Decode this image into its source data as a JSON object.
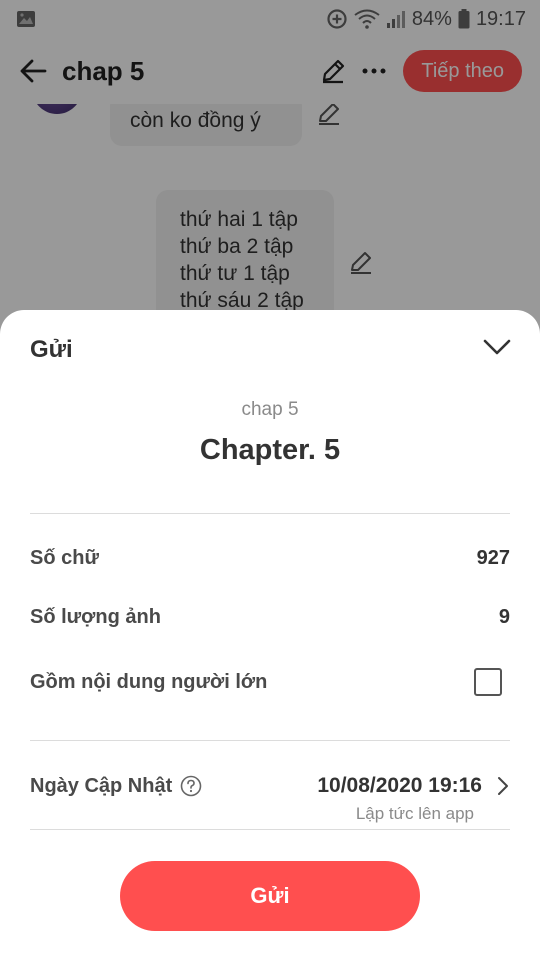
{
  "status_bar": {
    "battery": "84%",
    "time": "19:17"
  },
  "app_bar": {
    "title": "chap 5",
    "next_label": "Tiếp theo"
  },
  "chat": {
    "message_1": "còn ko đồng ý",
    "message_2_lines": [
      "thứ hai 1 tập",
      "thứ ba 2 tập",
      "thứ tư 1 tập",
      "thứ sáu 2 tập"
    ]
  },
  "sheet": {
    "title": "Gửi",
    "chapter_sub": "chap 5",
    "chapter_name": "Chapter. 5",
    "word_count_label": "Số chữ",
    "word_count_value": "927",
    "image_count_label": "Số lượng ảnh",
    "image_count_value": "9",
    "adult_label": "Gồm nội dung người lớn",
    "adult_checked": false,
    "date_label": "Ngày Cập Nhật",
    "date_value": "10/08/2020 19:16",
    "date_sub": "Lập tức lên app",
    "send_label": "Gửi"
  },
  "colors": {
    "accent": "#ff4f4f",
    "overlay": "rgba(0,0,0,0.40)",
    "text_dark": "#333333",
    "text_muted": "#8a8a8a"
  }
}
